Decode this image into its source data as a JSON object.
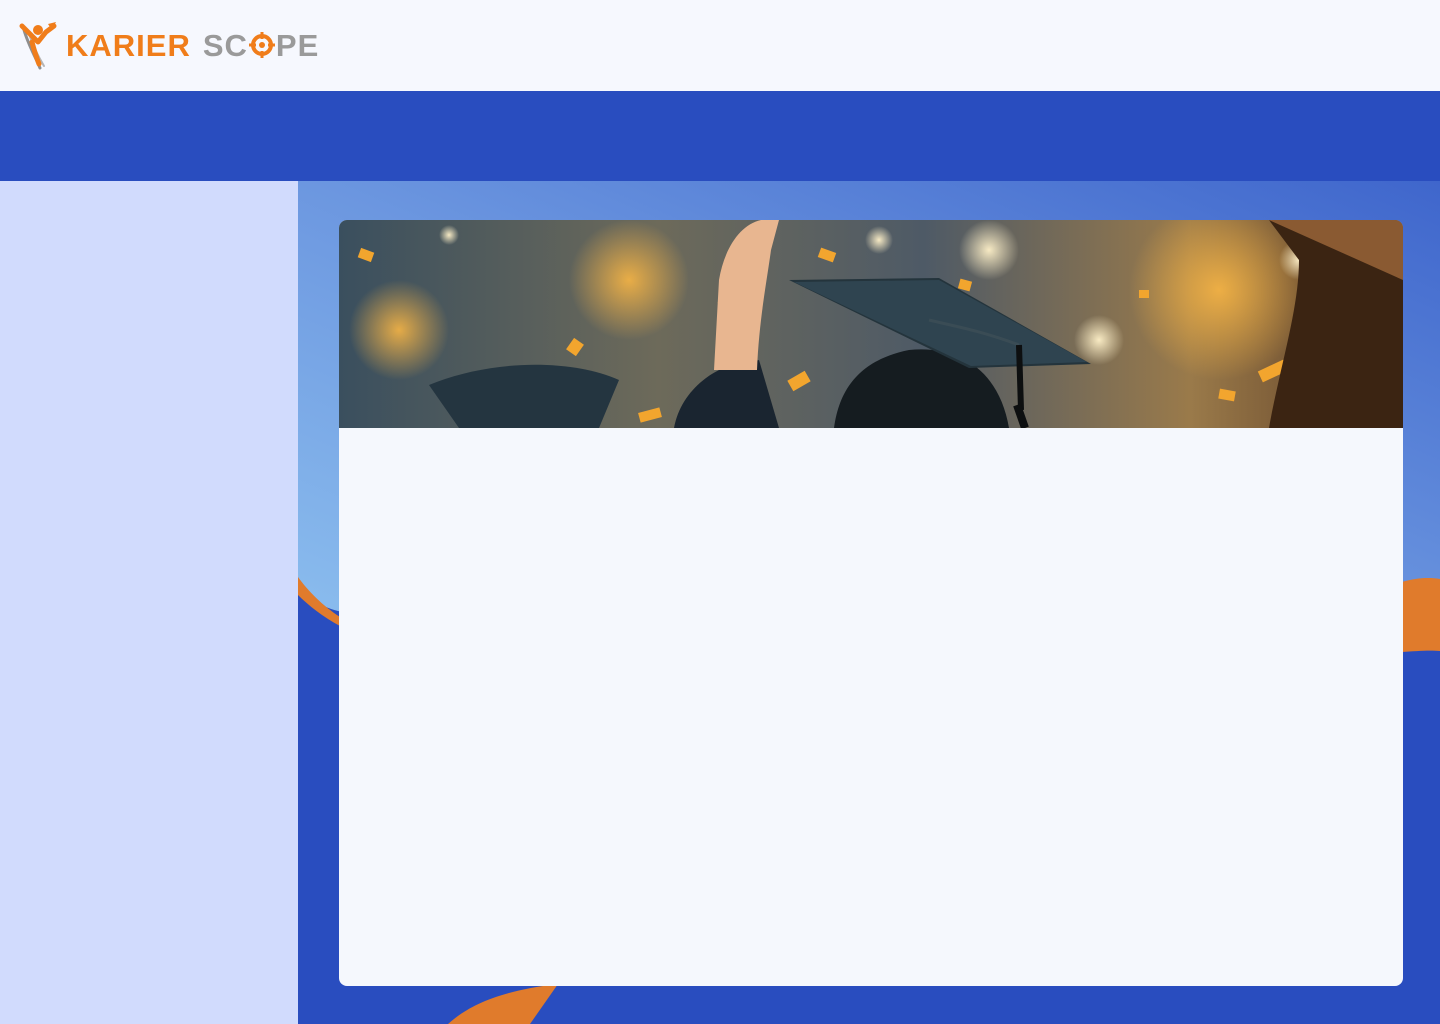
{
  "brand": {
    "name_part1": "KARIER",
    "name_part2_a": "SC",
    "name_part2_b": "PE",
    "colors": {
      "orange": "#f07d1a",
      "gray": "#9a9a9a",
      "navy": "#294dbf",
      "sidebar": "#d1dbfd",
      "card": "#f5f8fd"
    }
  },
  "icons": {
    "logo_mark": "person-arrow-logo-icon",
    "logo_target": "target-icon"
  },
  "banner": {
    "subject": "graduation-celebration-banner"
  }
}
